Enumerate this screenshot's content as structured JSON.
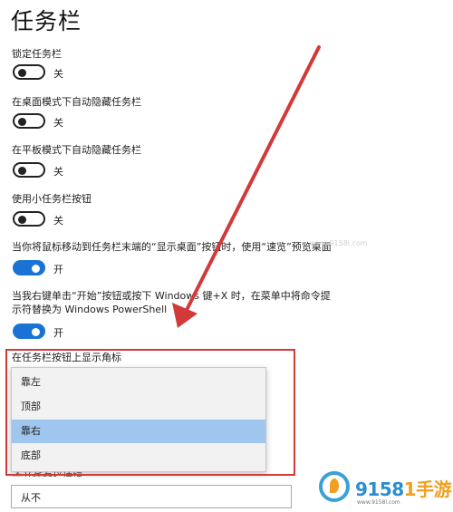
{
  "page": {
    "title": "任务栏"
  },
  "settings": [
    {
      "label": "锁定任务栏",
      "state": "关",
      "on": false
    },
    {
      "label": "在桌面模式下自动隐藏任务栏",
      "state": "关",
      "on": false
    },
    {
      "label": "在平板模式下自动隐藏任务栏",
      "state": "关",
      "on": false
    },
    {
      "label": "使用小任务栏按钮",
      "state": "关",
      "on": false
    },
    {
      "label": "当你将鼠标移动到任务栏末端的“显示桌面”按钮时，使用“速览”预览桌面",
      "state": "开",
      "on": true
    },
    {
      "label_line1": "当我右键单击“开始”按钮或按下 Windows 键+X 时，在菜单中将命令提",
      "label_line2": "示符替换为 Windows PowerShell",
      "state": "开",
      "on": true
    }
  ],
  "taskbar_location": {
    "label": "在任务栏按钮上显示角标",
    "options": [
      "靠左",
      "顶部",
      "靠右",
      "底部"
    ],
    "selected": "靠右"
  },
  "combine_buttons": {
    "label": "合并任务栏按钮",
    "value": "从不"
  },
  "watermark": {
    "brand_main": "9158",
    "brand_accent": "1手游",
    "url": "www.9158l.com",
    "faint_text": "www.9158l.com"
  },
  "colors": {
    "toggle_on": "#1a73d4",
    "highlight_border": "#d23a3a",
    "selected_item": "#9ec6ee",
    "arrow": "#d23a3a"
  }
}
